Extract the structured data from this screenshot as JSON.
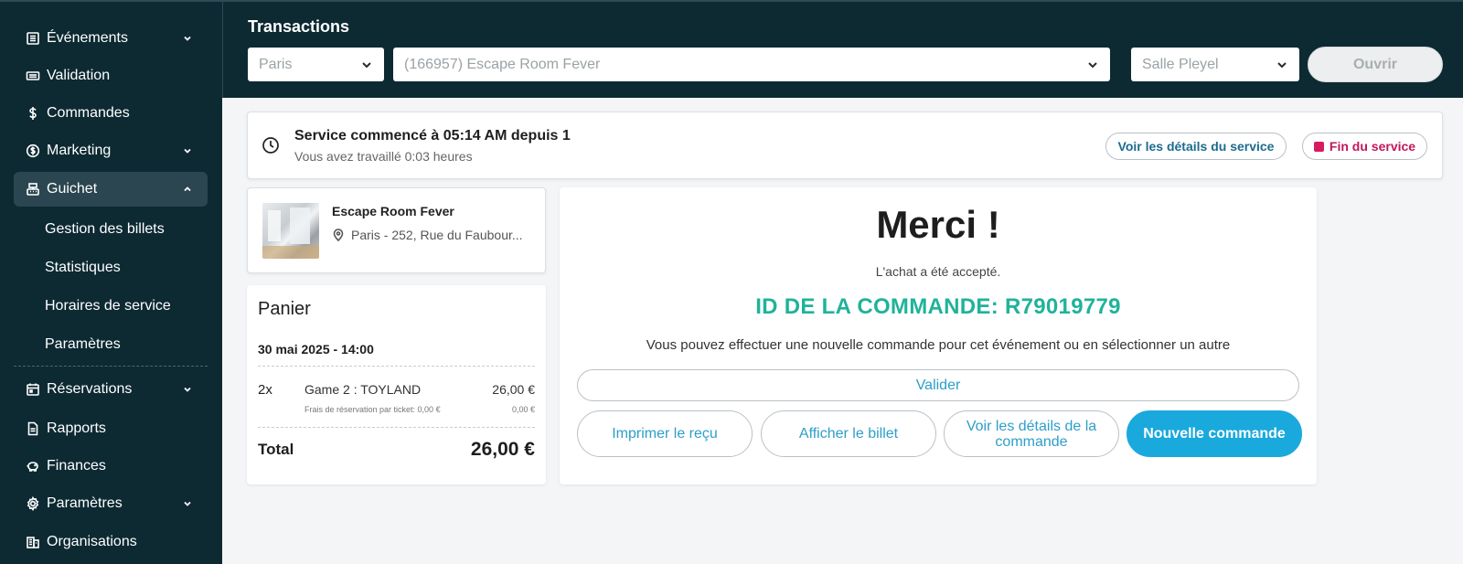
{
  "sidebar": {
    "items": [
      {
        "label": "Événements",
        "icon": "list-icon",
        "expandable": true
      },
      {
        "label": "Validation",
        "icon": "ticket-icon",
        "expandable": false
      },
      {
        "label": "Commandes",
        "icon": "dollar-icon",
        "expandable": false
      },
      {
        "label": "Marketing",
        "icon": "coin-icon",
        "expandable": true
      },
      {
        "label": "Guichet",
        "icon": "cash-register-icon",
        "expandable": true,
        "active": true,
        "children": [
          "Gestion des billets",
          "Statistiques",
          "Horaires de service",
          "Paramètres"
        ]
      },
      {
        "label": "Réservations",
        "icon": "calendar-icon",
        "expandable": true
      },
      {
        "label": "Rapports",
        "icon": "document-icon",
        "expandable": false
      },
      {
        "label": "Finances",
        "icon": "piggy-bank-icon",
        "expandable": false
      },
      {
        "label": "Paramètres",
        "icon": "gear-icon",
        "expandable": true
      },
      {
        "label": "Organisations",
        "icon": "building-icon",
        "expandable": false
      }
    ]
  },
  "topbar": {
    "title": "Transactions",
    "city_select": "Paris",
    "event_select": "(166957) Escape Room Fever",
    "venue_select": "Salle Pleyel",
    "open_button": "Ouvrir"
  },
  "service": {
    "title": "Service commencé à 05:14 AM depuis 1",
    "subtitle": "Vous avez travaillé 0:03 heures",
    "details_button": "Voir les détails du service",
    "end_button": "Fin du service"
  },
  "event": {
    "name": "Escape Room Fever",
    "location": "Paris - 252, Rue du Faubour..."
  },
  "cart": {
    "title": "Panier",
    "date": "30 mai 2025 - 14:00",
    "items": [
      {
        "qty": "2x",
        "name": "Game 2 : TOYLAND",
        "price": "26,00 €",
        "fee_label": "Frais de réservation par ticket: 0,00 €",
        "fee_price": "0,00 €"
      }
    ],
    "total_label": "Total",
    "total_value": "26,00 €"
  },
  "confirmation": {
    "title": "Merci !",
    "accepted": "L'achat a été accepté.",
    "order_id": "ID DE LA COMMANDE: R79019779",
    "hint": "Vous pouvez effectuer une nouvelle commande pour cet événement ou en sélectionner un autre",
    "validate_button": "Valider",
    "print_button": "Imprimer le reçu",
    "show_ticket_button": "Afficher le billet",
    "order_details_button": "Voir les détails de la commande",
    "new_order_button": "Nouvelle commande"
  },
  "colors": {
    "sidebar_bg": "#0d2a33",
    "accent_blue": "#1aa9dd",
    "order_id_green": "#1fb39a",
    "end_service_red": "#d81b60"
  }
}
